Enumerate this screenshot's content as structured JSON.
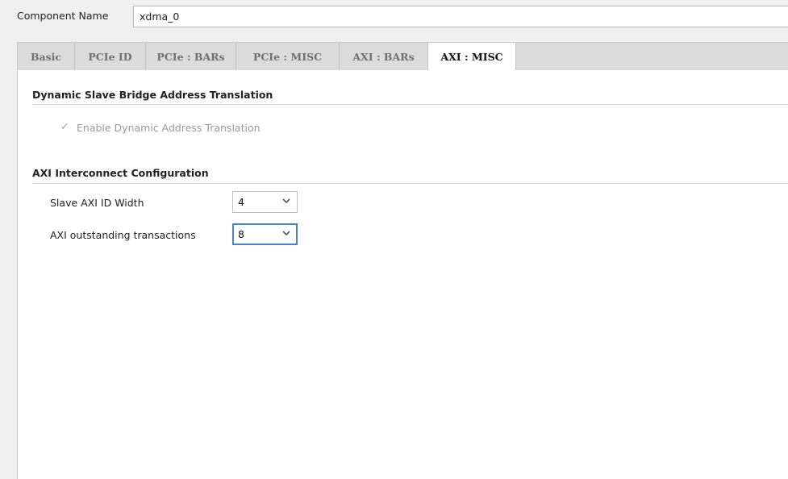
{
  "component": {
    "label": "Component Name",
    "value": "xdma_0"
  },
  "tabs": [
    {
      "label": "Basic",
      "active": false
    },
    {
      "label": "PCIe ID",
      "active": false
    },
    {
      "label": "PCIe : BARs",
      "active": false
    },
    {
      "label": "PCIe : MISC",
      "active": false
    },
    {
      "label": "AXI : BARs",
      "active": false
    },
    {
      "label": "AXI : MISC",
      "active": true
    }
  ],
  "dynamic_bridge": {
    "title": "Dynamic Slave Bridge Address Translation",
    "checkbox_label": "Enable Dynamic Address Translation",
    "checked": true,
    "enabled": false
  },
  "interconnect": {
    "title": "AXI Interconnect Configuration",
    "slave_id_width": {
      "label": "Slave AXI ID Width",
      "value": "4"
    },
    "outstanding": {
      "label": "AXI outstanding transactions",
      "value": "8"
    }
  },
  "icons": {
    "checkbox": "check-icon",
    "dropdown": "chevron-down-icon"
  },
  "colors": {
    "focus_border": "#4a7fc1",
    "disabled_text": "#9a9a9a"
  }
}
